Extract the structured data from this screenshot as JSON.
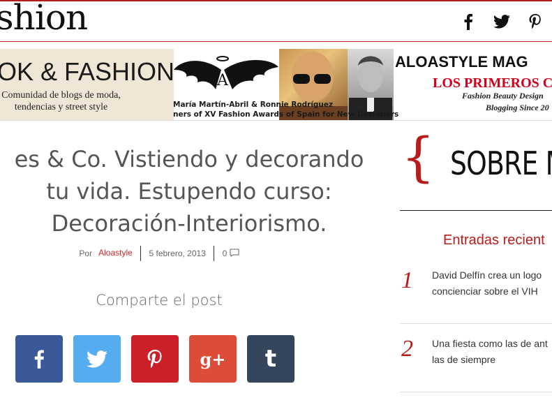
{
  "header": {
    "logo_text": "shion",
    "social": [
      "facebook-icon",
      "twitter-icon",
      "pinterest-icon"
    ]
  },
  "banner": {
    "left_title": "OK & FASHION",
    "left_subtitle_line1": "Comunidad de blogs de moda,",
    "left_subtitle_line2": "tendencias y street style",
    "caption_line1": "María Martín-Abril & Ronnie Rodríguez",
    "caption_line2": "ners of XV Fashion Awards of Spain for New Designers",
    "mag_title": "ALOASTYLE MAG",
    "mag_sub": "LOS PRIMEROS CON L",
    "mag_tag1": "Fashion  Beauty Design",
    "mag_tag2": "Blogging Since 20"
  },
  "post": {
    "title_line1": "es & Co. Vistiendo y decorando",
    "title_line2": "tu vida. Estupendo curso:",
    "title_line3": "Decoración-Interiorismo.",
    "meta_by": "Por",
    "meta_author": "Aloastyle",
    "meta_date": "5 febrero, 2013",
    "meta_comments": "0"
  },
  "share": {
    "title": "Comparte el post",
    "buttons": [
      {
        "name": "facebook",
        "color": "#3b5998"
      },
      {
        "name": "twitter",
        "color": "#55acee"
      },
      {
        "name": "pinterest",
        "color": "#cb2027"
      },
      {
        "name": "google-plus",
        "color": "#dd4b39"
      },
      {
        "name": "tumblr",
        "color": "#35465c"
      }
    ]
  },
  "sidebar": {
    "brace": "{",
    "about_title": "SOBRE M",
    "recent_title": "Entradas recient",
    "recent": [
      {
        "num": "1",
        "line1": "David Delfín crea un logo",
        "line2": "concienciar sobre el VIH"
      },
      {
        "num": "2",
        "line1": "Una fiesta como las de ant",
        "line2": "las de siempre"
      }
    ]
  },
  "colors": {
    "accent": "#b71c1c"
  }
}
